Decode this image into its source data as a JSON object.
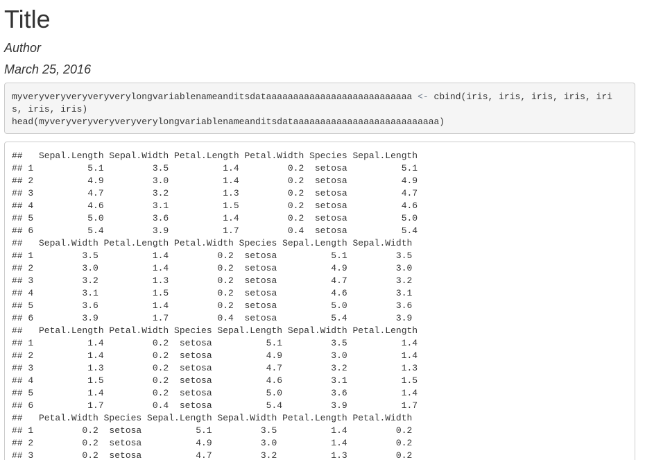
{
  "document": {
    "title": "Title",
    "author": "Author",
    "date": "March 25, 2016"
  },
  "code": {
    "line1_var": "myveryveryveryveryverylongvariablenameanditsdataaaaaaaaaaaaaaaaaaaaaaaaaaa",
    "line1_op": " <- ",
    "line1_call": "cbind(iris, iris, iris, iris, iri",
    "line2": "s, iris, iris)",
    "line3": "head(myveryveryveryveryverylongvariablenameanditsdataaaaaaaaaaaaaaaaaaaaaaaaaaa)"
  },
  "output": {
    "lines": [
      "##   Sepal.Length Sepal.Width Petal.Length Petal.Width Species Sepal.Length",
      "## 1          5.1         3.5          1.4         0.2  setosa          5.1",
      "## 2          4.9         3.0          1.4         0.2  setosa          4.9",
      "## 3          4.7         3.2          1.3         0.2  setosa          4.7",
      "## 4          4.6         3.1          1.5         0.2  setosa          4.6",
      "## 5          5.0         3.6          1.4         0.2  setosa          5.0",
      "## 6          5.4         3.9          1.7         0.4  setosa          5.4",
      "##   Sepal.Width Petal.Length Petal.Width Species Sepal.Length Sepal.Width",
      "## 1         3.5          1.4         0.2  setosa          5.1         3.5",
      "## 2         3.0          1.4         0.2  setosa          4.9         3.0",
      "## 3         3.2          1.3         0.2  setosa          4.7         3.2",
      "## 4         3.1          1.5         0.2  setosa          4.6         3.1",
      "## 5         3.6          1.4         0.2  setosa          5.0         3.6",
      "## 6         3.9          1.7         0.4  setosa          5.4         3.9",
      "##   Petal.Length Petal.Width Species Sepal.Length Sepal.Width Petal.Length",
      "## 1          1.4         0.2  setosa          5.1         3.5          1.4",
      "## 2          1.4         0.2  setosa          4.9         3.0          1.4",
      "## 3          1.3         0.2  setosa          4.7         3.2          1.3",
      "## 4          1.5         0.2  setosa          4.6         3.1          1.5",
      "## 5          1.4         0.2  setosa          5.0         3.6          1.4",
      "## 6          1.7         0.4  setosa          5.4         3.9          1.7",
      "##   Petal.Width Species Sepal.Length Sepal.Width Petal.Length Petal.Width",
      "## 1         0.2  setosa          5.1         3.5          1.4         0.2",
      "## 2         0.2  setosa          4.9         3.0          1.4         0.2",
      "## 3         0.2  setosa          4.7         3.2          1.3         0.2"
    ]
  }
}
